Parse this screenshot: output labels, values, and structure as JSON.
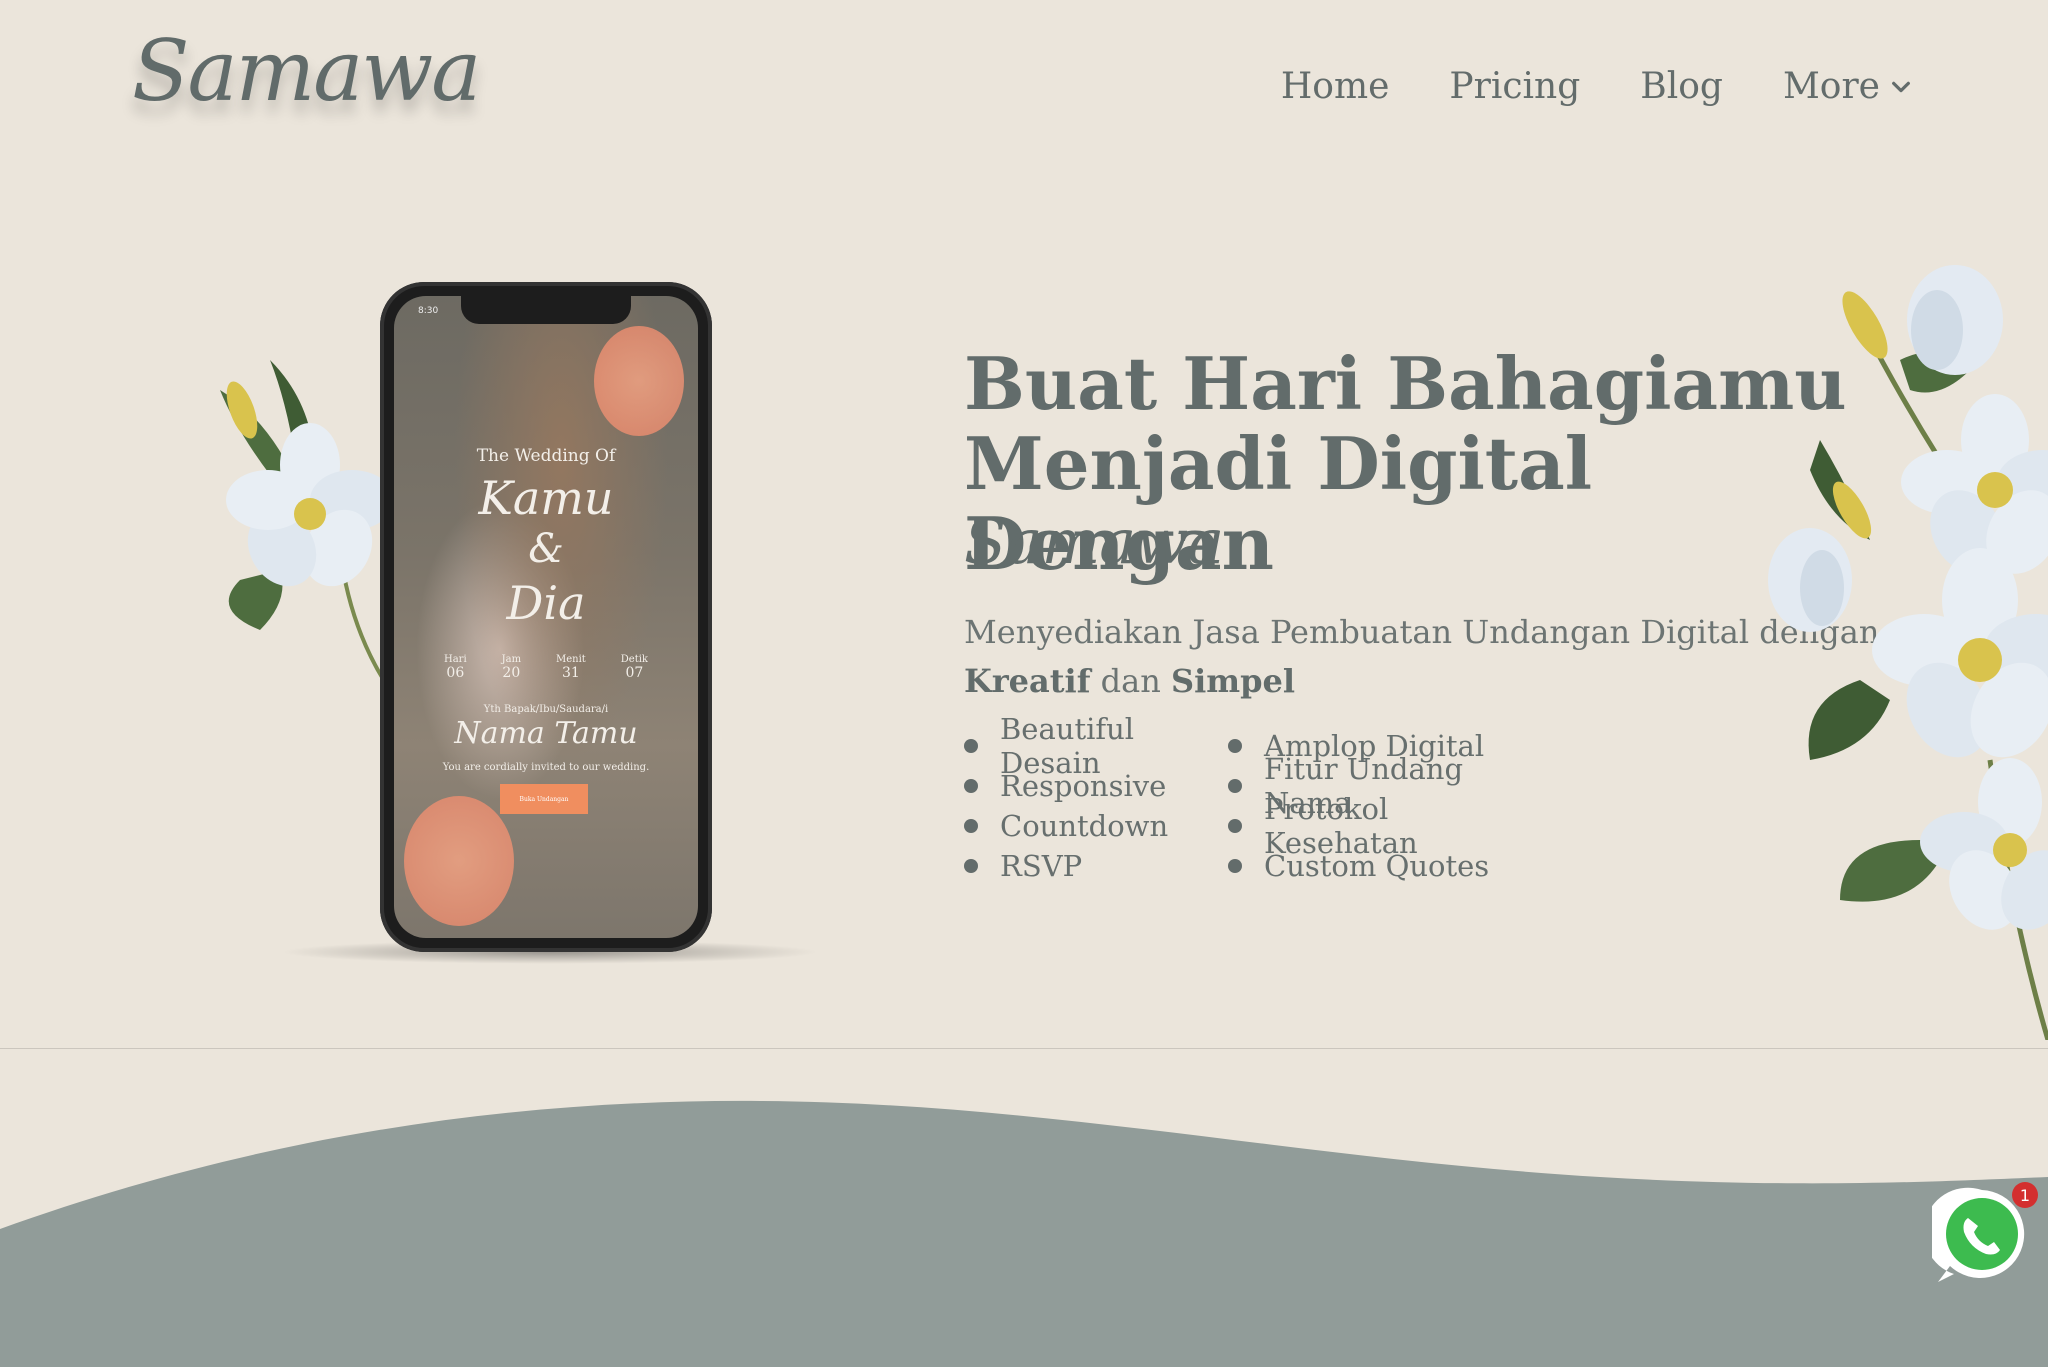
{
  "header": {
    "logo": "Samawa",
    "nav": [
      {
        "label": "Home"
      },
      {
        "label": "Pricing"
      },
      {
        "label": "Blog"
      },
      {
        "label": "More"
      }
    ]
  },
  "phone_mockup": {
    "time": "8:30",
    "subtitle": "The Wedding Of",
    "name1": "Kamu",
    "ampersand": "&",
    "name2": "Dia",
    "countdown": [
      {
        "label": "Hari",
        "value": "06"
      },
      {
        "label": "Jam",
        "value": "20"
      },
      {
        "label": "Menit",
        "value": "31"
      },
      {
        "label": "Detik",
        "value": "07"
      }
    ],
    "yth": "Yth Bapak/Ibu/Saudara/i",
    "guest": "Nama Tamu",
    "invite": "You are cordially invited to our wedding.",
    "button": "Buka Undangan"
  },
  "hero": {
    "title_line1": "Buat Hari Bahagiamu",
    "title_line2": "Menjadi Digital Dengan",
    "brand": "Samawa",
    "desc_prefix": "Menyediakan Jasa Pembuatan Undangan Digital dengan",
    "desc_bold1": "Kreatif",
    "desc_mid": "dan",
    "desc_bold2": "Simpel",
    "features": [
      "Beautiful Desain",
      "Amplop Digital",
      "Responsive",
      "Fitur Undang Nama",
      "Countdown",
      "Protokol Kesehatan",
      "RSVP",
      "Custom Quotes"
    ]
  },
  "whatsapp": {
    "badge": "1"
  },
  "colors": {
    "background": "#ebe5db",
    "text": "#626c6b",
    "wave": "#919c99",
    "accent_button": "#f08e5f",
    "whatsapp_green": "#3dbb4f"
  }
}
